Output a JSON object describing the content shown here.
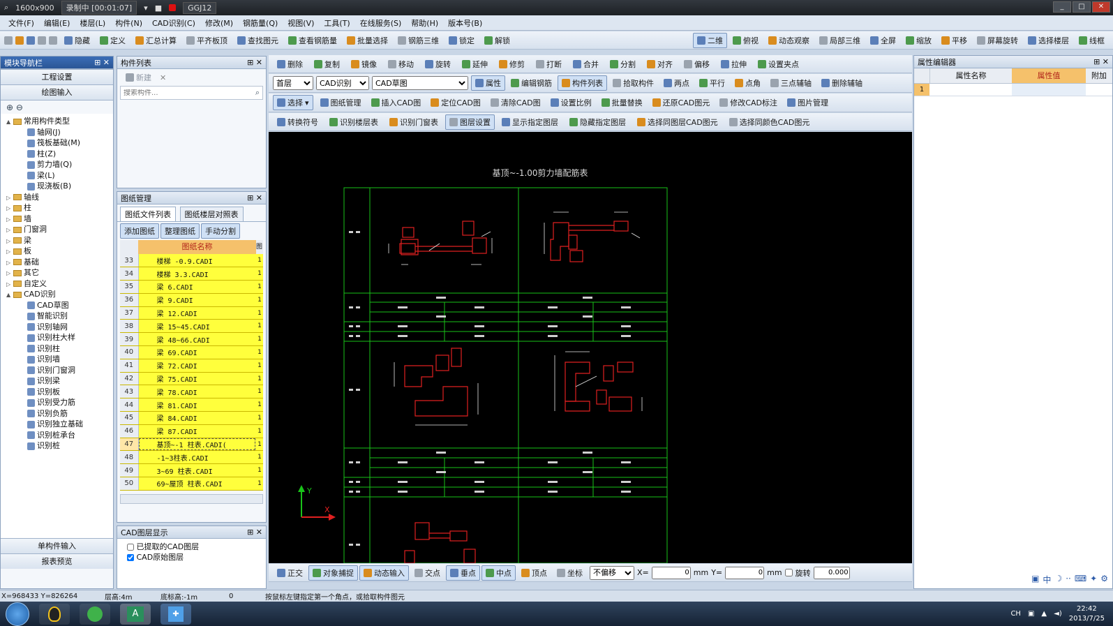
{
  "recorder": {
    "resolution": "1600x900",
    "status": "录制中 [00:01:07]",
    "app_tag": "GGJ12"
  },
  "menu": [
    "文件(F)",
    "编辑(E)",
    "楼层(L)",
    "构件(N)",
    "CAD识别(C)",
    "修改(M)",
    "钢筋量(Q)",
    "视图(V)",
    "工具(T)",
    "在线服务(S)",
    "帮助(H)",
    "版本号(B)"
  ],
  "toolbar1": {
    "left": [
      "隐藏",
      "定义",
      "汇总计算",
      "平齐板顶",
      "查找图元",
      "查看钢筋量",
      "批量选择",
      "钢筋三维",
      "锁定",
      "解锁"
    ],
    "right": [
      "二维",
      "俯视",
      "动态观察",
      "局部三维",
      "全屏",
      "缩放",
      "平移",
      "屏幕旋转",
      "选择楼层",
      "线框"
    ]
  },
  "toolbar2": [
    "删除",
    "复制",
    "镜像",
    "移动",
    "旋转",
    "延伸",
    "修剪",
    "打断",
    "合并",
    "分割",
    "对齐",
    "偏移",
    "拉伸",
    "设置夹点"
  ],
  "toolbar3": {
    "floor": "首层",
    "cad_type": "CAD识别",
    "cad_sub": "CAD草图",
    "buttons": [
      "属性",
      "编辑钢筋",
      "构件列表",
      "拾取构件",
      "两点",
      "平行",
      "点角",
      "三点辅轴",
      "删除辅轴"
    ]
  },
  "toolbar4": {
    "select": "选择",
    "buttons": [
      "图纸管理",
      "插入CAD图",
      "定位CAD图",
      "清除CAD图",
      "设置比例",
      "批量替换",
      "还原CAD图元",
      "修改CAD标注",
      "图片管理"
    ]
  },
  "toolbar5": [
    "转换符号",
    "识别楼层表",
    "识别门窗表",
    "图层设置",
    "显示指定图层",
    "隐藏指定图层",
    "选择同图层CAD图元",
    "选择同颜色CAD图元"
  ],
  "nav": {
    "title": "模块导航栏",
    "sections": [
      "工程设置",
      "绘图输入"
    ],
    "bottom": [
      "单构件输入",
      "报表预览"
    ],
    "tree": [
      {
        "t": "常用构件类型",
        "lvl": 0,
        "type": "folder",
        "ex": "▲"
      },
      {
        "t": "轴网(J)",
        "lvl": 1,
        "type": "item"
      },
      {
        "t": "筏板基础(M)",
        "lvl": 1,
        "type": "item"
      },
      {
        "t": "柱(Z)",
        "lvl": 1,
        "type": "item"
      },
      {
        "t": "剪力墙(Q)",
        "lvl": 1,
        "type": "item"
      },
      {
        "t": "梁(L)",
        "lvl": 1,
        "type": "item"
      },
      {
        "t": "现浇板(B)",
        "lvl": 1,
        "type": "item"
      },
      {
        "t": "轴线",
        "lvl": 0,
        "type": "folder",
        "ex": "▷"
      },
      {
        "t": "柱",
        "lvl": 0,
        "type": "folder",
        "ex": "▷"
      },
      {
        "t": "墙",
        "lvl": 0,
        "type": "folder",
        "ex": "▷"
      },
      {
        "t": "门窗洞",
        "lvl": 0,
        "type": "folder",
        "ex": "▷"
      },
      {
        "t": "梁",
        "lvl": 0,
        "type": "folder",
        "ex": "▷"
      },
      {
        "t": "板",
        "lvl": 0,
        "type": "folder",
        "ex": "▷"
      },
      {
        "t": "基础",
        "lvl": 0,
        "type": "folder",
        "ex": "▷"
      },
      {
        "t": "其它",
        "lvl": 0,
        "type": "folder",
        "ex": "▷"
      },
      {
        "t": "自定义",
        "lvl": 0,
        "type": "folder",
        "ex": "▷"
      },
      {
        "t": "CAD识别",
        "lvl": 0,
        "type": "folder",
        "ex": "▲"
      },
      {
        "t": "CAD草图",
        "lvl": 1,
        "type": "item"
      },
      {
        "t": "智能识别",
        "lvl": 1,
        "type": "item"
      },
      {
        "t": "识别轴网",
        "lvl": 1,
        "type": "item"
      },
      {
        "t": "识别柱大样",
        "lvl": 1,
        "type": "item"
      },
      {
        "t": "识别柱",
        "lvl": 1,
        "type": "item"
      },
      {
        "t": "识别墙",
        "lvl": 1,
        "type": "item"
      },
      {
        "t": "识别门窗洞",
        "lvl": 1,
        "type": "item"
      },
      {
        "t": "识别梁",
        "lvl": 1,
        "type": "item"
      },
      {
        "t": "识别板",
        "lvl": 1,
        "type": "item"
      },
      {
        "t": "识别受力筋",
        "lvl": 1,
        "type": "item"
      },
      {
        "t": "识别负筋",
        "lvl": 1,
        "type": "item"
      },
      {
        "t": "识别独立基础",
        "lvl": 1,
        "type": "item"
      },
      {
        "t": "识别桩承台",
        "lvl": 1,
        "type": "item"
      },
      {
        "t": "识别桩",
        "lvl": 1,
        "type": "item"
      }
    ]
  },
  "component_list": {
    "title": "构件列表",
    "new_btn": "新建",
    "search_placeholder": "搜索构件..."
  },
  "drawing_mgmt": {
    "title": "图纸管理",
    "tabs": [
      "图纸文件列表",
      "图纸楼层对照表"
    ],
    "buttons": [
      "添加图纸",
      "整理图纸",
      "手动分割"
    ],
    "col_name": "图纸名称",
    "col_flag": "图",
    "rows": [
      {
        "n": "33",
        "name": "楼梯 -0.9.CADI",
        "f": "1"
      },
      {
        "n": "34",
        "name": "楼梯 3.3.CADI",
        "f": "1"
      },
      {
        "n": "35",
        "name": "梁 6.CADI",
        "f": "1"
      },
      {
        "n": "36",
        "name": "梁 9.CADI",
        "f": "1"
      },
      {
        "n": "37",
        "name": "梁 12.CADI",
        "f": "1"
      },
      {
        "n": "38",
        "name": "梁 15~45.CADI",
        "f": "1"
      },
      {
        "n": "39",
        "name": "梁 48~66.CADI",
        "f": "1"
      },
      {
        "n": "40",
        "name": "梁 69.CADI",
        "f": "1"
      },
      {
        "n": "41",
        "name": "梁 72.CADI",
        "f": "1"
      },
      {
        "n": "42",
        "name": "梁 75.CADI",
        "f": "1"
      },
      {
        "n": "43",
        "name": "梁 78.CADI",
        "f": "1"
      },
      {
        "n": "44",
        "name": "梁 81.CADI",
        "f": "1"
      },
      {
        "n": "45",
        "name": "梁 84.CADI",
        "f": "1"
      },
      {
        "n": "46",
        "name": "梁 87.CADI",
        "f": "1"
      },
      {
        "n": "47",
        "name": "基顶~-1 柱表.CADI(",
        "f": "1",
        "selected": true
      },
      {
        "n": "48",
        "name": "-1~3柱表.CADI",
        "f": "1"
      },
      {
        "n": "49",
        "name": "3~69 柱表.CADI",
        "f": "1"
      },
      {
        "n": "50",
        "name": "69~屋顶 柱表.CADI",
        "f": "1"
      }
    ]
  },
  "cad_layers": {
    "title": "CAD图层显示",
    "items": [
      "已提取的CAD图层",
      "CAD原始图层"
    ]
  },
  "drawing": {
    "title": "基顶~-1.00剪力墙配筋表",
    "axis_y": "Y",
    "axis_x": "X"
  },
  "props": {
    "title": "属性编辑器",
    "cols": [
      "属性名称",
      "属性值",
      "附加"
    ],
    "row1": "1"
  },
  "snapbar": {
    "buttons": [
      "正交",
      "对象捕捉",
      "动态输入",
      "交点",
      "垂点",
      "中点",
      "顶点",
      "坐标"
    ],
    "offset_mode": "不偏移",
    "x_label": "X=",
    "x_val": "0",
    "mm": "mm",
    "y_label": "Y=",
    "y_val": "0",
    "rotate": "旋转",
    "rotate_val": "0.000"
  },
  "status": {
    "coords": "X=968433 Y=826264",
    "floor_h": "层高:4m",
    "base_h": "底标高:-1m",
    "zero": "0",
    "hint": "按鼠标左键指定第一个角点，或拾取构件图元"
  },
  "tray": {
    "lang": "CH",
    "time": "22:42",
    "date": "2013/7/25"
  }
}
